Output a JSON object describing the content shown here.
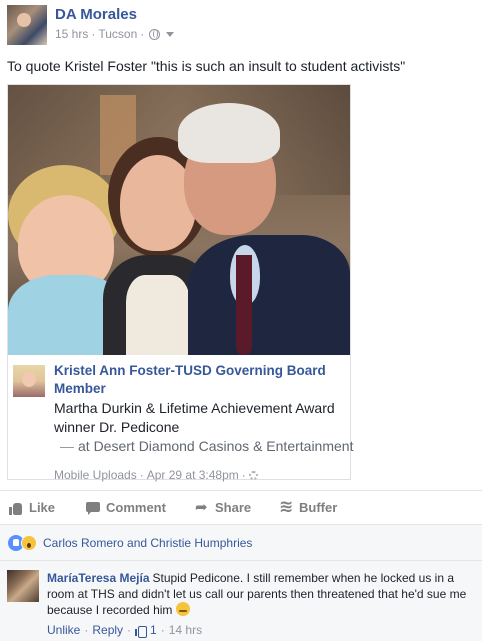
{
  "post": {
    "author": "DA Morales",
    "time": "15 hrs",
    "separator": "·",
    "location": "Tucson",
    "privacy_icon": "globe-icon",
    "text": "To quote Kristel Foster \"this is such an insult to student activists\""
  },
  "shared": {
    "title": "Kristel Ann Foster-TUSD Governing Board Member",
    "description": "Martha Durkin & Lifetime Achievement Award winner Dr. Pedicone",
    "location_prefix": "—",
    "location": "at Desert Diamond Casinos & Entertainment",
    "album": "Mobile Uploads",
    "date": "Apr 29 at 3:48pm",
    "separator": "·"
  },
  "actions": {
    "like": "Like",
    "comment": "Comment",
    "share": "Share",
    "buffer": "Buffer"
  },
  "reactions": {
    "names": "Carlos Romero and Christie Humphries"
  },
  "comment": {
    "author": "MaríaTeresa Mejía",
    "text": "Stupid Pedicone. I still remember when he locked us in a room at THS and didn't let us call our parents then threatened that he'd sue me because I recorded him",
    "unlike": "Unlike",
    "reply": "Reply",
    "separator": "·",
    "like_count": "1",
    "time": "14 hrs"
  },
  "colors": {
    "link_blue": "#365899",
    "meta_gray": "#90949c",
    "action_gray": "#7f7f7f",
    "like_blue": "#5890ff",
    "wow_yellow": "#f7c33c"
  }
}
